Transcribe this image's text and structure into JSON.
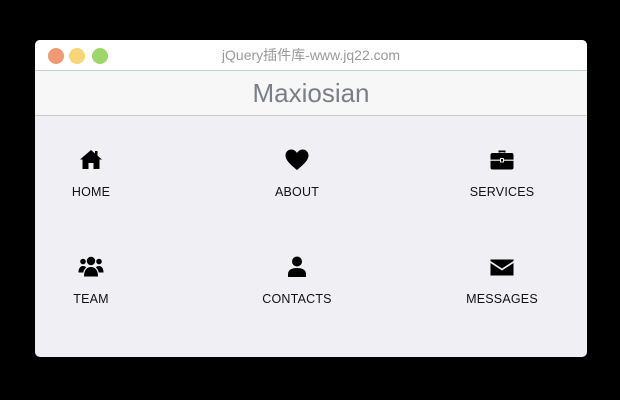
{
  "window": {
    "title": "jQuery插件库-www.jq22.com",
    "controls": {
      "close_color": "#ef9a72",
      "minimize_color": "#f5d776",
      "zoom_color": "#9ed66c"
    }
  },
  "app": {
    "title": "Maxiosian"
  },
  "menu": {
    "items": [
      {
        "label": "HOME",
        "icon": "home-icon"
      },
      {
        "label": "ABOUT",
        "icon": "heart-icon"
      },
      {
        "label": "SERVICES",
        "icon": "briefcase-icon"
      },
      {
        "label": "TEAM",
        "icon": "users-icon"
      },
      {
        "label": "CONTACTS",
        "icon": "user-icon"
      },
      {
        "label": "MESSAGES",
        "icon": "envelope-icon"
      }
    ]
  },
  "colors": {
    "page_background": "#000000",
    "window_background": "#efeff4",
    "header_background": "#f7f7f8",
    "title_text": "#7a7f86",
    "icon": "#000000"
  }
}
